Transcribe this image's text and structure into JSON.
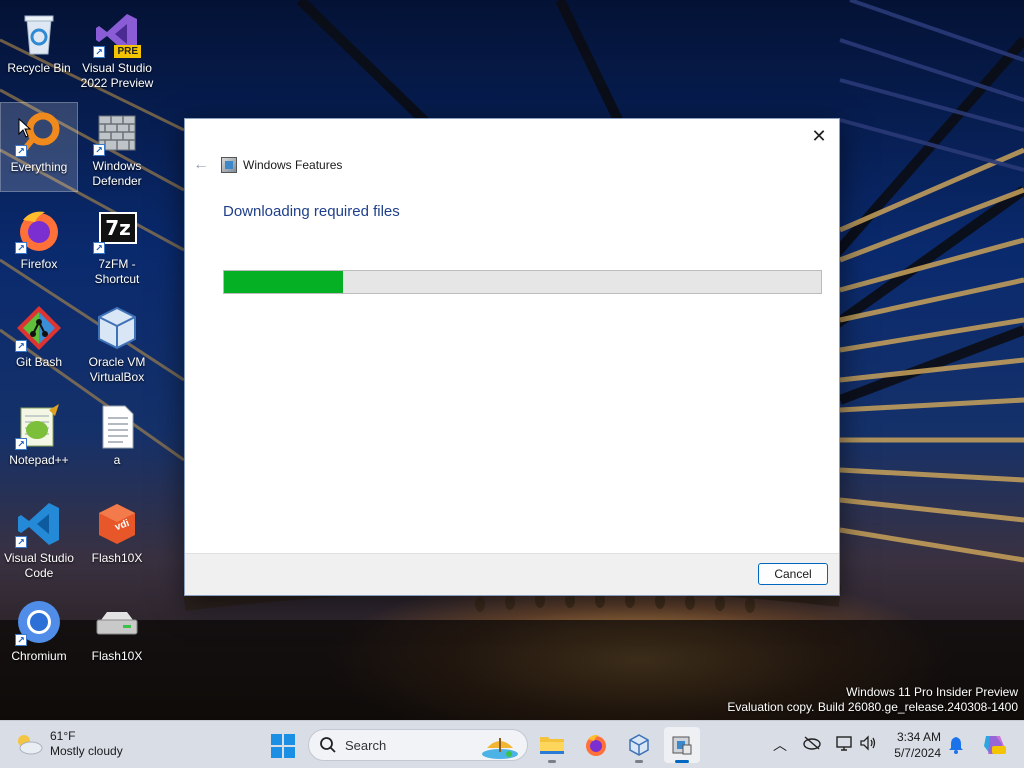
{
  "desktop": {
    "icons": [
      {
        "label": "Recycle Bin",
        "icon": "recycle-bin-icon"
      },
      {
        "label": "Visual Studio 2022 Preview",
        "icon": "visual-studio-preview-icon",
        "badge": "PRE"
      },
      {
        "label": "Everything",
        "icon": "everything-search-icon"
      },
      {
        "label": "Windows Defender",
        "icon": "windows-defender-icon"
      },
      {
        "label": "Firefox",
        "icon": "firefox-icon"
      },
      {
        "label": "7zFM - Shortcut",
        "icon": "7zip-icon",
        "badge": "7z"
      },
      {
        "label": "Git Bash",
        "icon": "git-bash-icon"
      },
      {
        "label": "Oracle VM VirtualBox",
        "icon": "virtualbox-icon"
      },
      {
        "label": "Notepad++",
        "icon": "notepad-plus-plus-icon"
      },
      {
        "label": "a",
        "icon": "text-file-icon"
      },
      {
        "label": "Visual Studio Code",
        "icon": "vscode-icon"
      },
      {
        "label": "Flash10X",
        "icon": "flash10x-vdi-icon",
        "badge": "vdi"
      },
      {
        "label": "Chromium",
        "icon": "chromium-icon"
      },
      {
        "label": "Flash10X",
        "icon": "drive-icon"
      }
    ]
  },
  "dialog": {
    "title": "Windows Features",
    "heading": "Downloading required files",
    "progress": 0.2,
    "cancel_label": "Cancel",
    "close_glyph": "✕",
    "back_glyph": "←"
  },
  "watermark": {
    "line1": "Windows 11 Pro Insider Preview",
    "line2": "Evaluation copy. Build 26080.ge_release.240308-1400"
  },
  "taskbar": {
    "weather": {
      "temp": "61°F",
      "condition": "Mostly cloudy"
    },
    "search_placeholder": "Search",
    "apps": [
      "file-explorer",
      "firefox",
      "virtualbox",
      "windows-features"
    ],
    "clock": {
      "time": "3:34 AM",
      "date": "5/7/2024"
    },
    "colors": {
      "accent": "#0067c0",
      "progress": "#06b025"
    }
  }
}
